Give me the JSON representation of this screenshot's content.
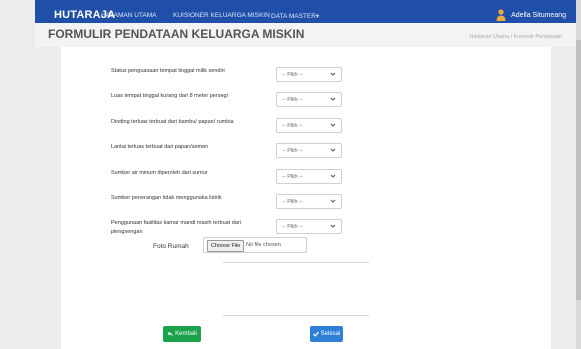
{
  "navbar": {
    "brand": "HUTARAJA",
    "links": [
      "HALAMAN UTAMA",
      "KUISIONER KELUARGA MISKIN",
      "DATA MASTER"
    ],
    "data_master_caret": "▾",
    "user_name": "Adella Situmeang"
  },
  "page": {
    "title": "FORMULIR PENDATAAN KELUARGA MISKIN",
    "breadcrumb": "Halaman Utama  /  Formulir Pendataan"
  },
  "questions": [
    {
      "label": "Status penguasaan tempat tinggal milik sendiri",
      "value": "-- Pilih --"
    },
    {
      "label": "Luas tempat tinggal kurang dari 8 meter persegi",
      "value": "-- Pilih --"
    },
    {
      "label": "Dinding terluas terbuat dari bambu/ papan/ rumbia",
      "value": "-- Pilih --"
    },
    {
      "label": "Lantai terluas terbuat dari papan/semen",
      "value": "-- Pilih --"
    },
    {
      "label": "Sumber air minum diperoleh dari sumur",
      "value": "-- Pilih --"
    },
    {
      "label": "Sumber penerangan tidak menggunaka listrik",
      "value": "-- Pilih --"
    },
    {
      "label": "Penggunaan fasilitas kamar mandi masih terbuat dari plengsengan",
      "value": "-- Pilih --"
    }
  ],
  "photo": {
    "label": "Foto Rumah",
    "choose_button": "Choose File",
    "no_file_text": "No file chosen"
  },
  "buttons": {
    "back": "Kembali",
    "finish": "Selesai"
  },
  "colors": {
    "navbar": "#1f4fa8",
    "back_button": "#1aa34a",
    "finish_button": "#2e7fd6"
  }
}
